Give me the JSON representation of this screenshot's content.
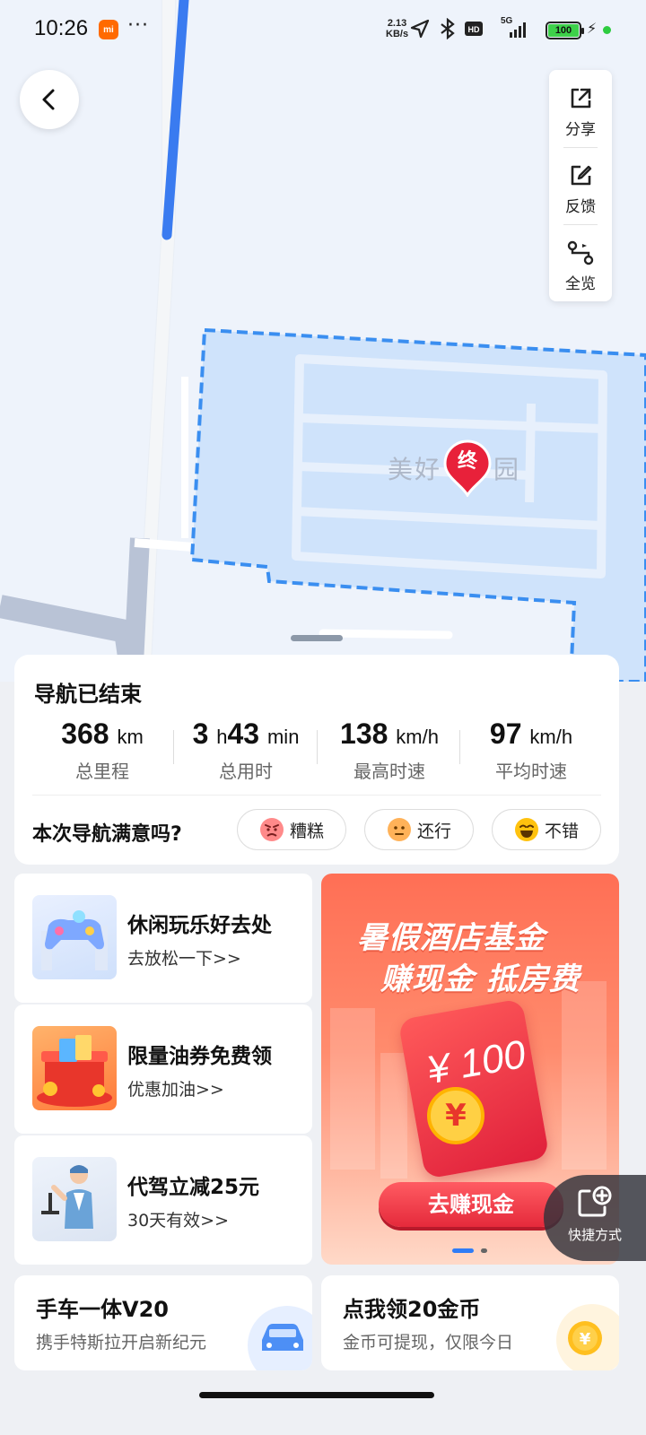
{
  "status_bar": {
    "time": "10:26",
    "brand_badge": "mi",
    "more": "···",
    "net_speed_value": "2.13",
    "net_speed_unit": "KB/s",
    "network": "5G",
    "battery": "100"
  },
  "map": {
    "destination_name": "美好",
    "destination_name_tail": "园",
    "end_pin_label": "终",
    "route_color": "#3a7bf0",
    "area_color": "#3a8ef0"
  },
  "tools": {
    "share": "分享",
    "feedback": "反馈",
    "overview": "全览"
  },
  "summary": {
    "title": "导航已结束",
    "stats": [
      {
        "value": "368",
        "unit": "km",
        "caption": "总里程"
      },
      {
        "value_h": "3",
        "unit_h": "h",
        "value_m": "43",
        "unit_m": "min",
        "caption": "总用时"
      },
      {
        "value": "138",
        "unit": "km/h",
        "caption": "最高时速"
      },
      {
        "value": "97",
        "unit": "km/h",
        "caption": "平均时速"
      }
    ],
    "question": "本次导航满意吗?",
    "ratings": [
      "糟糕",
      "还行",
      "不错"
    ]
  },
  "promos": [
    {
      "title": "休闲玩乐好去处",
      "subtitle": "去放松一下>>",
      "icon": "gamepad-icon"
    },
    {
      "title": "限量油券免费领",
      "subtitle": "优惠加油>>",
      "icon": "gift-box-icon"
    },
    {
      "title": "代驾立减25元",
      "subtitle": "30天有效>>",
      "icon": "driver-icon"
    }
  ],
  "banner": {
    "line1": "暑假酒店基金",
    "line2": "赚现金 抵房费",
    "amount": "¥ 100",
    "coin": "¥",
    "cta": "去赚现金"
  },
  "quick_access": {
    "label": "快捷方式"
  },
  "bottom_cards": [
    {
      "title": "手车一体V20",
      "subtitle": "携手特斯拉开启新纪元",
      "icon": "car-icon"
    },
    {
      "title": "点我领20金币",
      "subtitle": "金币可提现，仅限今日",
      "icon": "gold-coin-icon"
    }
  ]
}
